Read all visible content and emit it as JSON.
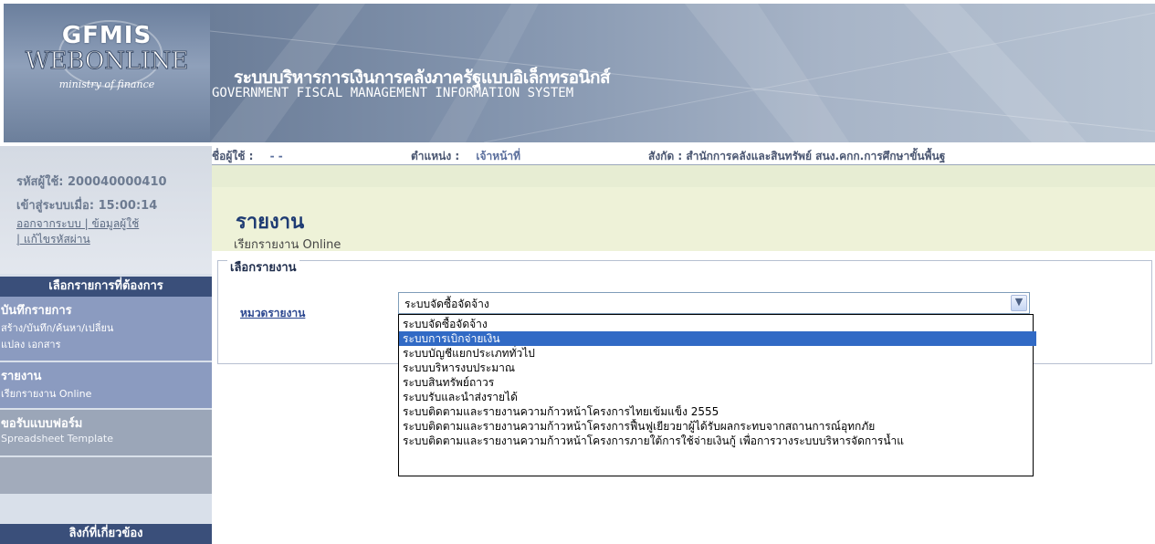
{
  "logo": {
    "line1": "GFMIS",
    "line2": "WEBONLINE",
    "line3": "ministry of finance"
  },
  "banner": {
    "title_th": "ระบบบริหารการเงินการคลังภาครัฐแบบอิเล็กทรอนิกส์",
    "title_en": "GOVERNMENT FISCAL MANAGEMENT INFORMATION SYSTEM"
  },
  "user": {
    "id_label": "รหัสผู้ใช้: 200040000410",
    "login_time": "เข้าสู่ระบบเมื่อ: 15:00:14",
    "links_line1": "ออกจากระบบ | ข้อมูลผู้ใช้",
    "links_line2": "| แก้ไขรหัสผ่าน"
  },
  "info_strip": {
    "username_label": "ชื่อผู้ใช้ :",
    "username_value": "- -",
    "position_label": "ตำแหน่ง :",
    "position_value": "เจ้าหน้าที่",
    "affiliation": "สังกัด : สำนักการคลังและสินทรัพย์ สนง.คกก.การศึกษาขั้นพื้นฐ"
  },
  "sidebar": {
    "section_title": "เลือกรายการที่ต้องการ",
    "items": [
      {
        "title": "บันทึกรายการ",
        "sub": "สร้าง/บันทึก/ค้นหา/เปลี่ยน"
      },
      {
        "title": "",
        "sub": "แปลง เอกสาร"
      },
      {
        "title": "รายงาน",
        "sub": "เรียกรายงาน Online"
      },
      {
        "title": "ขอรับแบบฟอร์ม",
        "sub": "Spreadsheet Template"
      }
    ],
    "related_links": "ลิงก์ที่เกี่ยวข้อง"
  },
  "page": {
    "title": "รายงาน",
    "subtitle": "เรียกรายงาน Online",
    "legend": "เลือกรายงาน"
  },
  "report_form": {
    "category_label": "หมวดรายงาน",
    "selected": "ระบบจัดซื้อจัดจ้าง",
    "options": [
      "ระบบจัดซื้อจัดจ้าง",
      "ระบบการเบิกจ่ายเงิน",
      "ระบบบัญชีแยกประเภททั่วไป",
      "ระบบบริหารงบประมาณ",
      "ระบบสินทรัพย์ถาวร",
      "ระบบรับและนำส่งรายได้",
      "ระบบติดตามและรายงานความก้าวหน้าโครงการไทยเข้มแข็ง 2555",
      "ระบบติดตามและรายงานความก้าวหน้าโครงการฟื้นฟูเยียวยาผู้ได้รับผลกระทบจากสถานการณ์อุทกภัย",
      "ระบบติดตามและรายงานความก้าวหน้าโครงการภายใต้การใช้จ่ายเงินกู้ เพื่อการวางระบบบริหารจัดการน้ำแ"
    ],
    "highlighted_index": 1
  },
  "colors": {
    "nav_dark": "#3a4f7a",
    "highlight": "#316ac5",
    "title_blue": "#1e3b73",
    "banner_green": "#eef2d8"
  }
}
